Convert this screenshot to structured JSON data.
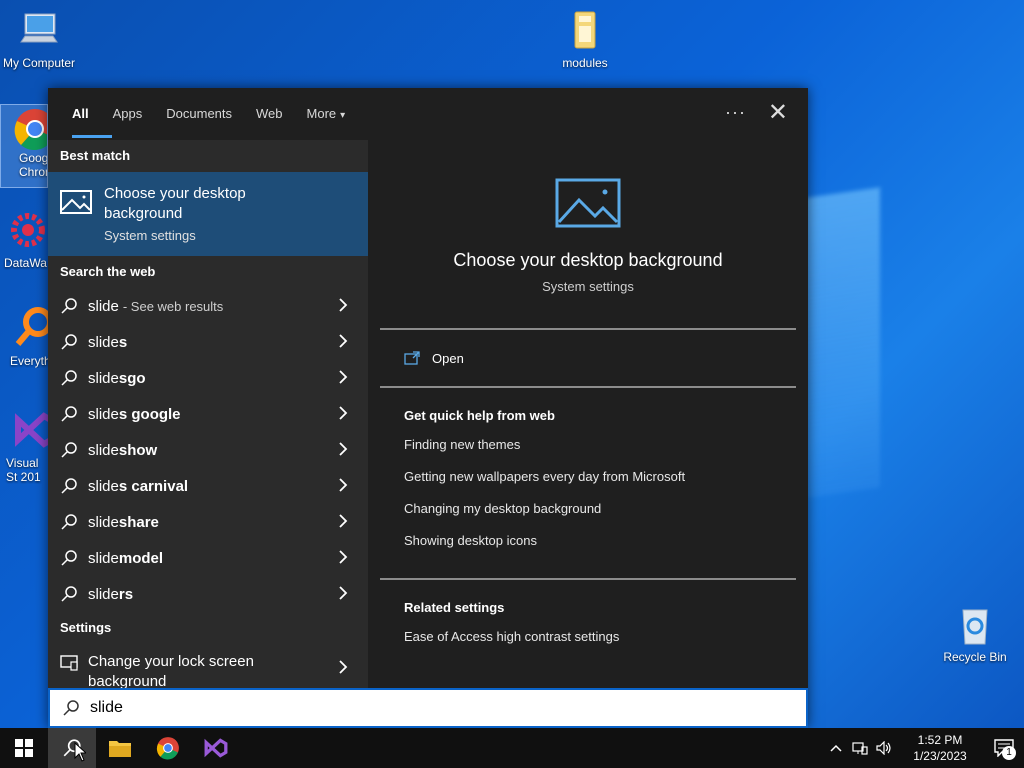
{
  "desktop": {
    "icons": [
      {
        "label": "My Computer"
      },
      {
        "label": "modules"
      },
      {
        "label": "Goog Chrom"
      },
      {
        "label": "DataWa"
      },
      {
        "label": "Everyth"
      },
      {
        "label": "Visual St 201"
      },
      {
        "label": "Recycle Bin"
      }
    ]
  },
  "search_panel": {
    "tabs": [
      {
        "label": "All"
      },
      {
        "label": "Apps"
      },
      {
        "label": "Documents"
      },
      {
        "label": "Web"
      },
      {
        "label": "More"
      }
    ],
    "more_caret": "▾",
    "dots": "···",
    "close": "✕",
    "best_match": {
      "header": "Best match",
      "title": "Choose your desktop background",
      "subtitle": "System settings"
    },
    "web_section": {
      "header": "Search the web",
      "items": [
        {
          "prefix": "slide",
          "bold": "",
          "hint": "- See web results"
        },
        {
          "prefix": "slide",
          "bold": "s",
          "hint": ""
        },
        {
          "prefix": "slide",
          "bold": "sgo",
          "hint": ""
        },
        {
          "prefix": "slide",
          "bold": "s google",
          "hint": ""
        },
        {
          "prefix": "slide",
          "bold": "show",
          "hint": ""
        },
        {
          "prefix": "slide",
          "bold": "s carnival",
          "hint": ""
        },
        {
          "prefix": "slide",
          "bold": "share",
          "hint": ""
        },
        {
          "prefix": "slide",
          "bold": "model",
          "hint": ""
        },
        {
          "prefix": "slide",
          "bold": "rs",
          "hint": ""
        }
      ]
    },
    "settings_section": {
      "header": "Settings",
      "items": [
        {
          "label": "Change your lock screen background"
        }
      ]
    },
    "preview": {
      "title": "Choose your desktop background",
      "subtitle": "System settings",
      "open_label": "Open",
      "help_header": "Get quick help from web",
      "help_links": [
        "Finding new themes",
        "Getting new wallpapers every day from Microsoft",
        "Changing my desktop background",
        "Showing desktop icons"
      ],
      "related_header": "Related settings",
      "related_links": [
        "Ease of Access high contrast settings"
      ]
    }
  },
  "searchbar": {
    "value": "slide"
  },
  "taskbar": {
    "time": "1:52 PM",
    "date": "1/23/2023",
    "notification_count": "1"
  },
  "colors": {
    "accent": "#4aa2f0",
    "best_match_bg": "#1e4d78",
    "panel_bg": "#1f1f1f"
  }
}
